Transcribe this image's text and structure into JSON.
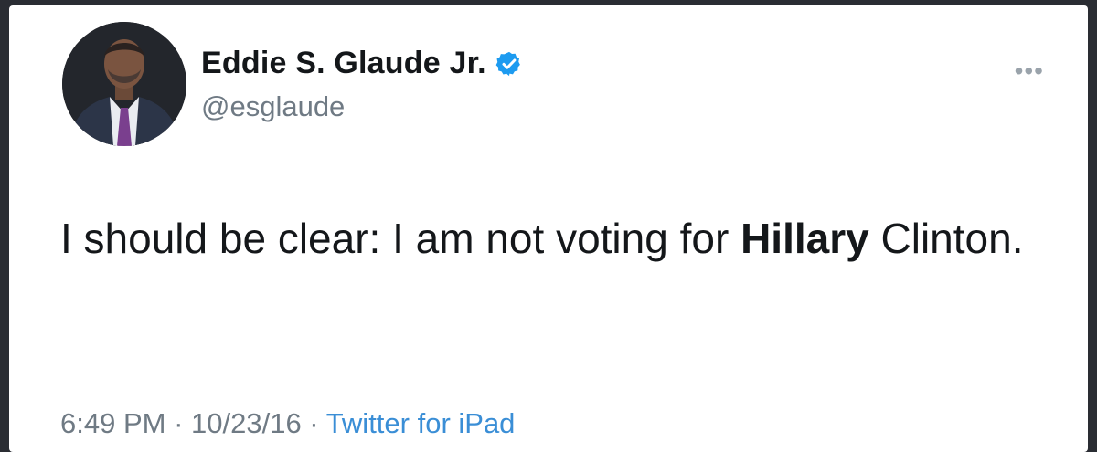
{
  "tweet": {
    "author": {
      "display_name": "Eddie S. Glaude Jr.",
      "handle": "@esglaude",
      "verified": true,
      "avatar_icon": "person-avatar"
    },
    "text": {
      "part1": "I should be clear: I am not voting for ",
      "bold": "Hillary",
      "part2": " Clinton."
    },
    "meta": {
      "time": "6:49 PM",
      "separator": " · ",
      "date": "10/23/16",
      "source": "Twitter for iPad"
    },
    "more_icon": "ellipsis-icon"
  },
  "colors": {
    "background": "#2a2d33",
    "card": "#ffffff",
    "text": "#14171a",
    "secondary": "#6f7a84",
    "link": "#3a8ed6",
    "verified": "#1d9bf0"
  }
}
